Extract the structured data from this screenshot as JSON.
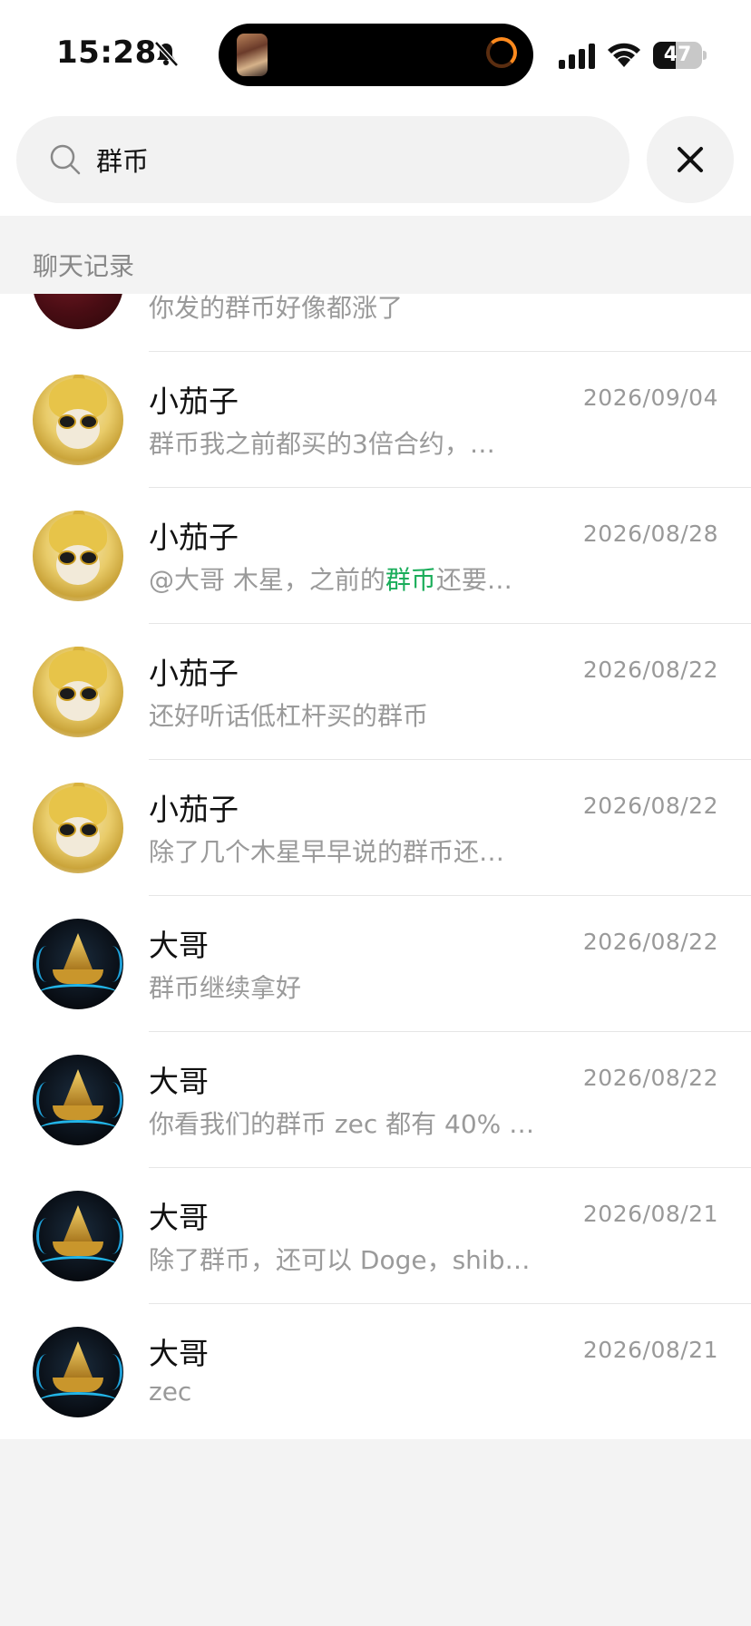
{
  "status_bar": {
    "time": "15:28",
    "battery": "47",
    "battery_level": 0.47
  },
  "search": {
    "query": "群币",
    "placeholder": ""
  },
  "section": {
    "title": "聊天记录"
  },
  "results": [
    {
      "name": "",
      "date": "",
      "snippet_before": "你发的群币好像都涨了",
      "snippet_highlight": "",
      "snippet_after": "",
      "avatar": "rose-avatar"
    },
    {
      "name": "小茄子",
      "date": "2026/09/04",
      "snippet_before": "群币我之前都买的3倍合约，…",
      "snippet_highlight": "",
      "snippet_after": "",
      "avatar": "cat-avatar"
    },
    {
      "name": "小茄子",
      "date": "2026/08/28",
      "snippet_before": "@大哥 木星，之前的",
      "snippet_highlight": "群币",
      "snippet_after": "还要…",
      "avatar": "cat-avatar"
    },
    {
      "name": "小茄子",
      "date": "2026/08/22",
      "snippet_before": "还好听话低杠杆买的群币",
      "snippet_highlight": "",
      "snippet_after": "",
      "avatar": "cat-avatar"
    },
    {
      "name": "小茄子",
      "date": "2026/08/22",
      "snippet_before": "除了几个木星早早说的群币还…",
      "snippet_highlight": "",
      "snippet_after": "",
      "avatar": "cat-avatar"
    },
    {
      "name": "大哥",
      "date": "2026/08/22",
      "snippet_before": "群币继续拿好",
      "snippet_highlight": "",
      "snippet_after": "",
      "avatar": "ship-avatar"
    },
    {
      "name": "大哥",
      "date": "2026/08/22",
      "snippet_before": "你看我们的群币 zec 都有 40% …",
      "snippet_highlight": "",
      "snippet_after": "",
      "avatar": "ship-avatar"
    },
    {
      "name": "大哥",
      "date": "2026/08/21",
      "snippet_before": "除了群币，还可以 Doge，shib…",
      "snippet_highlight": "",
      "snippet_after": "",
      "avatar": "ship-avatar"
    },
    {
      "name": "大哥",
      "date": "2026/08/21",
      "snippet_before": "zec",
      "snippet_highlight": "",
      "snippet_after": "",
      "avatar": "ship-avatar"
    }
  ],
  "icons": {
    "search": "search-icon",
    "close": "close-icon",
    "bell": "bell-slash-icon",
    "signal": "cellular-signal-icon",
    "wifi": "wifi-icon",
    "battery": "battery-icon"
  },
  "colors": {
    "highlight": "#1aad5a",
    "secondary_text": "#9a9a9a",
    "background": "#f3f3f3"
  }
}
